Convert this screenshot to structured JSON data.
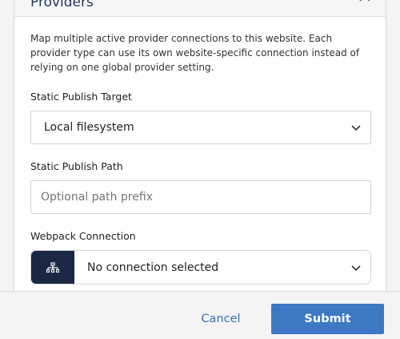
{
  "panel": {
    "title": "Providers",
    "description": "Map multiple active provider connections to this website. Each provider type can use its own website-specific connection instead of relying on one global provider setting."
  },
  "fields": {
    "static_publish_target": {
      "label": "Static Publish Target",
      "value": "Local filesystem"
    },
    "static_publish_path": {
      "label": "Static Publish Path",
      "placeholder": "Optional path prefix"
    },
    "webpack_connection": {
      "label": "Webpack Connection",
      "value": "No connection selected",
      "icon": "sitemap-icon"
    }
  },
  "footer": {
    "cancel_label": "Cancel",
    "submit_label": "Submit"
  },
  "colors": {
    "accent": "#3d78c5",
    "icon_box": "#1a2844",
    "title": "#26375e"
  }
}
